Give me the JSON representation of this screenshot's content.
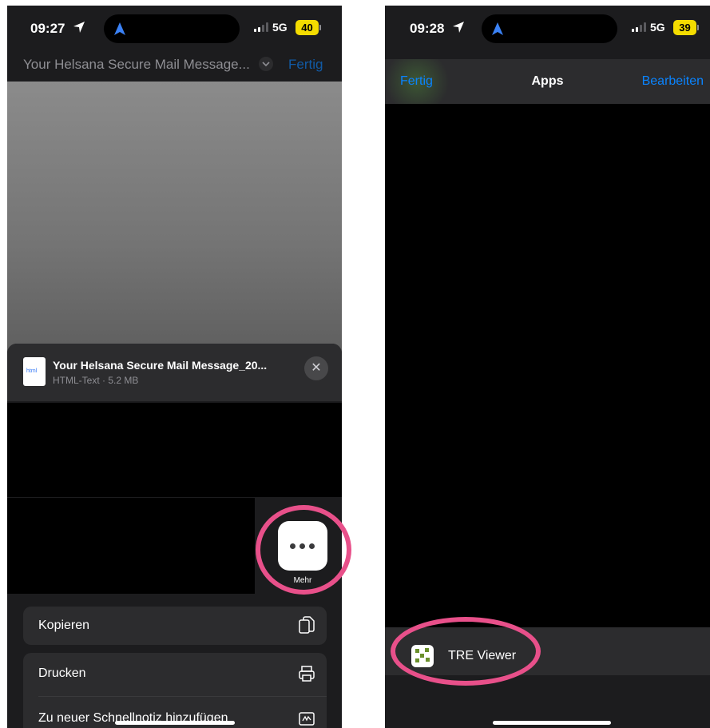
{
  "left_screen": {
    "status_bar": {
      "time": "09:27",
      "network": "5G",
      "battery": "40"
    },
    "nav": {
      "title": "Your Helsana Secure Mail Message...",
      "done_label": "Fertig"
    },
    "file": {
      "icon_text": "html",
      "name": "Your Helsana Secure Mail Message_20...",
      "meta": "HTML-Text · 5.2 MB"
    },
    "more_button": {
      "label": "Mehr",
      "icon": "ellipsis-icon"
    },
    "actions": [
      {
        "label": "Kopieren",
        "icon": "copy-icon"
      },
      {
        "label": "Drucken",
        "icon": "printer-icon"
      },
      {
        "label": "Zu neuer Schnellnotiz hinzufügen",
        "icon": "quick-note-icon"
      }
    ]
  },
  "right_screen": {
    "status_bar": {
      "time": "09:28",
      "network": "5G",
      "battery": "39"
    },
    "nav": {
      "done_label": "Fertig",
      "title": "Apps",
      "edit_label": "Bearbeiten"
    },
    "apps": [
      {
        "label": "TRE Viewer",
        "icon": "tre-viewer-icon"
      }
    ]
  },
  "colors": {
    "accent_blue": "#0a84ff",
    "annotation_pink": "#e8508a",
    "battery_yellow": "#f4dc00"
  }
}
